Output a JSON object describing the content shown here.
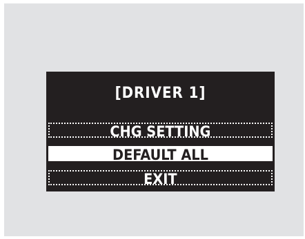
{
  "screen": {
    "title": "[DRIVER 1]"
  },
  "menu": {
    "items": [
      {
        "label": "CHG SETTING",
        "selected": false
      },
      {
        "label": "DEFAULT ALL",
        "selected": true
      },
      {
        "label": "EXIT",
        "selected": false
      }
    ]
  },
  "colors": {
    "background": "#e1e2e4",
    "screen": "#231f20",
    "text": "#ffffff",
    "highlight": "#ffffff"
  }
}
